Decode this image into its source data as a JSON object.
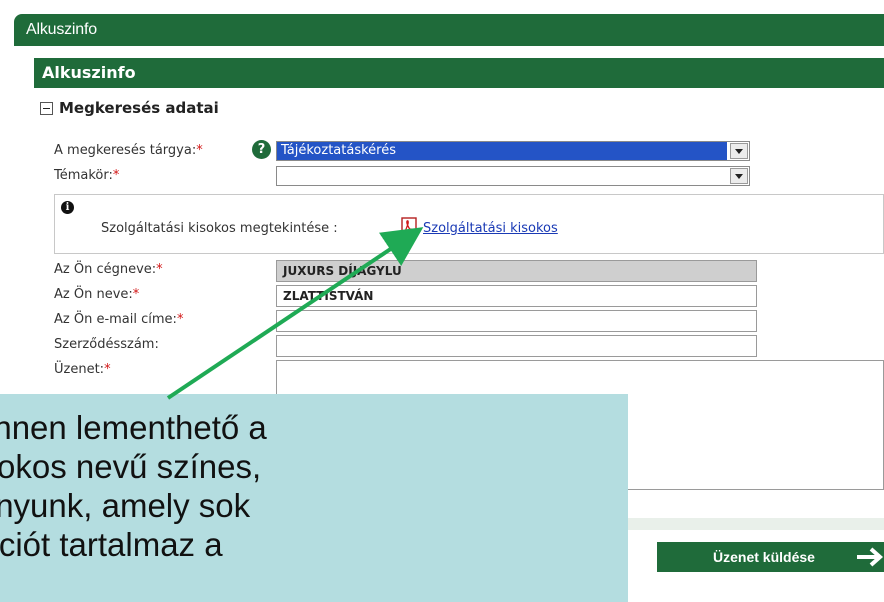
{
  "window": {
    "title": "Alkuszinfo"
  },
  "panel": {
    "title": "Alkuszinfo",
    "section_title": "Megkeresés adatai"
  },
  "form": {
    "subject_label": "A megkeresés tárgya:",
    "subject_value": "Tájékoztatáskérés",
    "topic_label": "Témakör:",
    "topic_value": "",
    "info_text": "Szolgáltatási kisokos megtekintése :",
    "info_link": "Szolgáltatási kisokos",
    "company_label": "Az Ön cégneve:",
    "company_value": "JUXURS DÍJAGYLU",
    "name_label": "Az Ön neve:",
    "name_value": "ZLATTISTVÁN",
    "email_label": "Az Ön e-mail címe:",
    "email_value": "",
    "contract_label": "Szerződésszám:",
    "contract_value": "",
    "message_label": "Üzenet:",
    "required_mark": "*"
  },
  "actions": {
    "send_label": "Üzenet küldése"
  },
  "callout": {
    "text": "es innen lementhető a\n Kisokos nevű színes,\ndványunk, amely sok\nrmációt tartalmaz a"
  },
  "icons": {
    "help": "help-icon",
    "info": "info-icon",
    "pdf": "pdf-icon",
    "collapse": "collapse-icon",
    "send_arrow": "arrow-right-icon"
  },
  "colors": {
    "brand_green": "#1f6b3a",
    "callout_bg": "#b4dde0",
    "annotation_arrow": "#1faa55",
    "required": "#d21414",
    "link": "#1a3ab5",
    "selection": "#2454c6"
  }
}
